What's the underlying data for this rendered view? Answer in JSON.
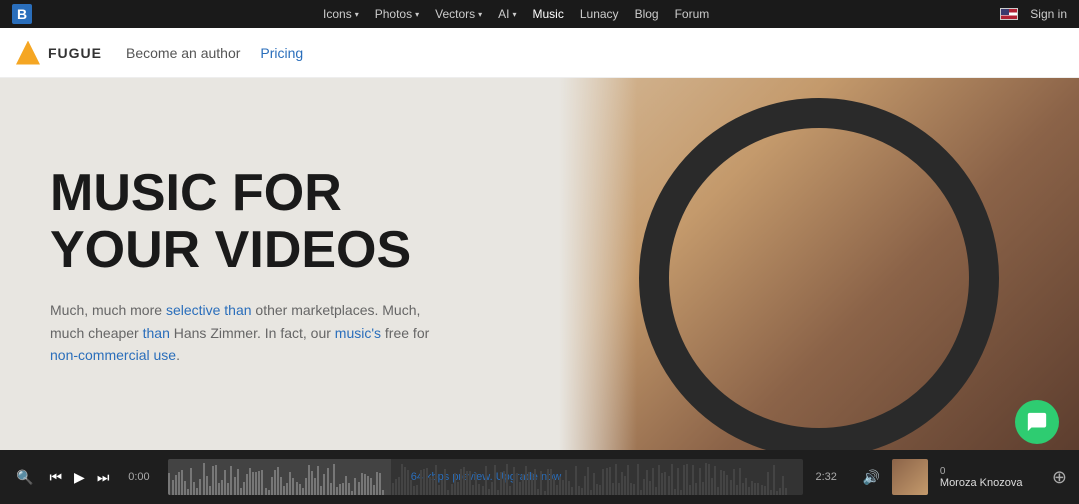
{
  "topNav": {
    "logoText": "B",
    "links": [
      {
        "label": "Icons",
        "hasDropdown": true,
        "active": false
      },
      {
        "label": "Photos",
        "hasDropdown": true,
        "active": false
      },
      {
        "label": "Vectors",
        "hasDropdown": true,
        "active": false
      },
      {
        "label": "AI",
        "hasDropdown": true,
        "active": false
      },
      {
        "label": "Music",
        "hasDropdown": false,
        "active": true
      },
      {
        "label": "Lunacy",
        "hasDropdown": false,
        "active": false
      },
      {
        "label": "Blog",
        "hasDropdown": false,
        "active": false
      },
      {
        "label": "Forum",
        "hasDropdown": false,
        "active": false
      }
    ],
    "signInLabel": "Sign in"
  },
  "secondNav": {
    "logoName": "FUGUE",
    "links": [
      {
        "label": "Become an author",
        "active": false
      },
      {
        "label": "Pricing",
        "active": true
      }
    ]
  },
  "hero": {
    "headline1": "MUSIC FOR",
    "headline2": "YOUR VIDEOS",
    "description": "Much, much more selective than other marketplaces. Much, much cheaper than Hans Zimmer. In fact, our music's free for non-commercial use."
  },
  "player": {
    "currentTime": "0:00",
    "endTime": "2:32",
    "previewText": "64 kbps preview.",
    "upgradeText": "Upgrade now",
    "trackCount": "0",
    "trackName": "Moroza Knozova"
  },
  "chatBubble": {
    "label": "chat"
  }
}
